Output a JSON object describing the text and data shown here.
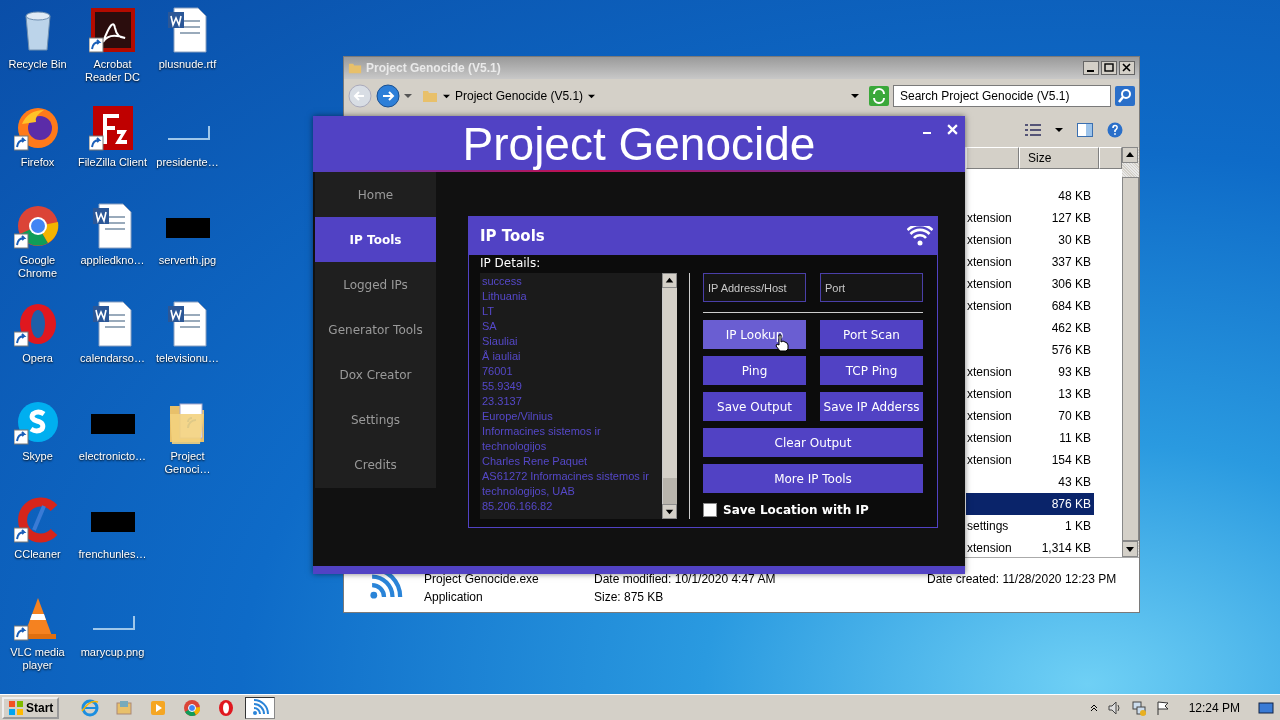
{
  "desktop": {
    "icons": [
      {
        "label": "Recycle Bin",
        "kind": "recycle",
        "shortcut": false
      },
      {
        "label": "Firefox",
        "kind": "firefox",
        "shortcut": true
      },
      {
        "label": "Google Chrome",
        "kind": "chrome",
        "shortcut": true
      },
      {
        "label": "Opera",
        "kind": "opera",
        "shortcut": true
      },
      {
        "label": "Skype",
        "kind": "skype",
        "shortcut": true
      },
      {
        "label": "CCleaner",
        "kind": "ccleaner",
        "shortcut": true
      },
      {
        "label": "VLC media player",
        "kind": "vlc",
        "shortcut": true
      },
      {
        "label": "Acrobat Reader DC",
        "kind": "acrobat",
        "shortcut": true
      },
      {
        "label": "FileZilla Client",
        "kind": "filezilla",
        "shortcut": true
      },
      {
        "label": "appliedkno…",
        "kind": "word",
        "shortcut": false
      },
      {
        "label": "calendarso…",
        "kind": "word",
        "shortcut": false
      },
      {
        "label": "electronicto…",
        "kind": "dark",
        "shortcut": false
      },
      {
        "label": "frenchunles…",
        "kind": "dark",
        "shortcut": false
      },
      {
        "label": "marycup.png",
        "kind": "blank",
        "shortcut": false
      },
      {
        "label": "plusnude.rtf",
        "kind": "word",
        "shortcut": false
      },
      {
        "label": "presidente…",
        "kind": "blank",
        "shortcut": false
      },
      {
        "label": "serverth.jpg",
        "kind": "dark",
        "shortcut": false
      },
      {
        "label": "televisionu…",
        "kind": "word",
        "shortcut": false
      },
      {
        "label": "Project Genoci…",
        "kind": "folder",
        "shortcut": false
      }
    ]
  },
  "explorer": {
    "title": "Project Genocide (V5.1)",
    "address": "Project Genocide (V5.1)",
    "search": {
      "placeholder": "Search Project Genocide (V5.1)"
    },
    "size_header": "Size",
    "rows": [
      {
        "size": "48 KB",
        "selected": false
      },
      {
        "type": "xtension",
        "size": "127 KB",
        "selected": false
      },
      {
        "type": "xtension",
        "size": "30 KB",
        "selected": false
      },
      {
        "type": "xtension",
        "size": "337 KB",
        "selected": false
      },
      {
        "type": "xtension",
        "size": "306 KB",
        "selected": false
      },
      {
        "type": "xtension",
        "size": "684 KB",
        "selected": false
      },
      {
        "size": "462 KB",
        "selected": false
      },
      {
        "size": "576 KB",
        "selected": false
      },
      {
        "type": "xtension",
        "size": "93 KB",
        "selected": false
      },
      {
        "type": "xtension",
        "size": "13 KB",
        "selected": false
      },
      {
        "type": "xtension",
        "size": "70 KB",
        "selected": false
      },
      {
        "type": "xtension",
        "size": "11 KB",
        "selected": false
      },
      {
        "type": "xtension",
        "size": "154 KB",
        "selected": false
      },
      {
        "size": "43 KB",
        "selected": false
      },
      {
        "size": "876 KB",
        "selected": true
      },
      {
        "type": "settings",
        "size": "1 KB",
        "selected": false
      },
      {
        "type": "xtension",
        "size": "1,314 KB",
        "selected": false
      }
    ],
    "details": {
      "name": "Project Genocide.exe",
      "modified": "Date modified: 10/1/2020 4:47 AM",
      "created": "Date created: 11/28/2020 12:23 PM",
      "type": "Application",
      "size": "Size: 875 KB"
    }
  },
  "app": {
    "title": "Project Genocide",
    "nav": [
      {
        "label": "Home",
        "selected": false
      },
      {
        "label": "IP Tools",
        "selected": true
      },
      {
        "label": "Logged IPs",
        "selected": false
      },
      {
        "label": "Generator Tools",
        "selected": false
      },
      {
        "label": "Dox Creator",
        "selected": false
      },
      {
        "label": "Settings",
        "selected": false
      },
      {
        "label": "Credits",
        "selected": false
      }
    ],
    "panel": {
      "title": "IP Tools",
      "details_label": "IP Details:",
      "output_lines": [
        "success",
        "Lithuania",
        "LT",
        "SA",
        "Siauliai",
        "Å iauliai",
        "76001",
        "55.9349",
        "23.3137",
        "Europe/Vilnius",
        "Informacines sistemos ir technologijos",
        "Charles Rene Paquet",
        "AS61272 Informacines sistemos ir technologijos, UAB",
        "85.206.166.82"
      ],
      "fields": [
        {
          "placeholder": "IP Address/Host"
        },
        {
          "placeholder": "Port"
        }
      ],
      "buttons": [
        {
          "label": "IP Lookup",
          "hovered": true,
          "wide": false
        },
        {
          "label": "Port Scan",
          "hovered": false,
          "wide": false
        },
        {
          "label": "Ping",
          "hovered": false,
          "wide": false
        },
        {
          "label": "TCP Ping",
          "hovered": false,
          "wide": false
        },
        {
          "label": "Save Output",
          "hovered": false,
          "wide": false
        },
        {
          "label": "Save IP Adderss",
          "hovered": false,
          "wide": false
        },
        {
          "label": "Clear Output",
          "hovered": false,
          "wide": true
        },
        {
          "label": "More IP Tools",
          "hovered": false,
          "wide": true
        }
      ],
      "checkbox": {
        "label": "Save Location with IP",
        "checked": false
      }
    }
  },
  "taskbar": {
    "start": "Start",
    "apps": [
      {
        "kind": "ie",
        "active": false
      },
      {
        "kind": "explorer",
        "active": false
      },
      {
        "kind": "media",
        "active": false
      },
      {
        "kind": "chrome",
        "active": false
      },
      {
        "kind": "opera",
        "active": false
      },
      {
        "kind": "wifi",
        "active": true
      }
    ],
    "clock": "12:24 PM"
  }
}
